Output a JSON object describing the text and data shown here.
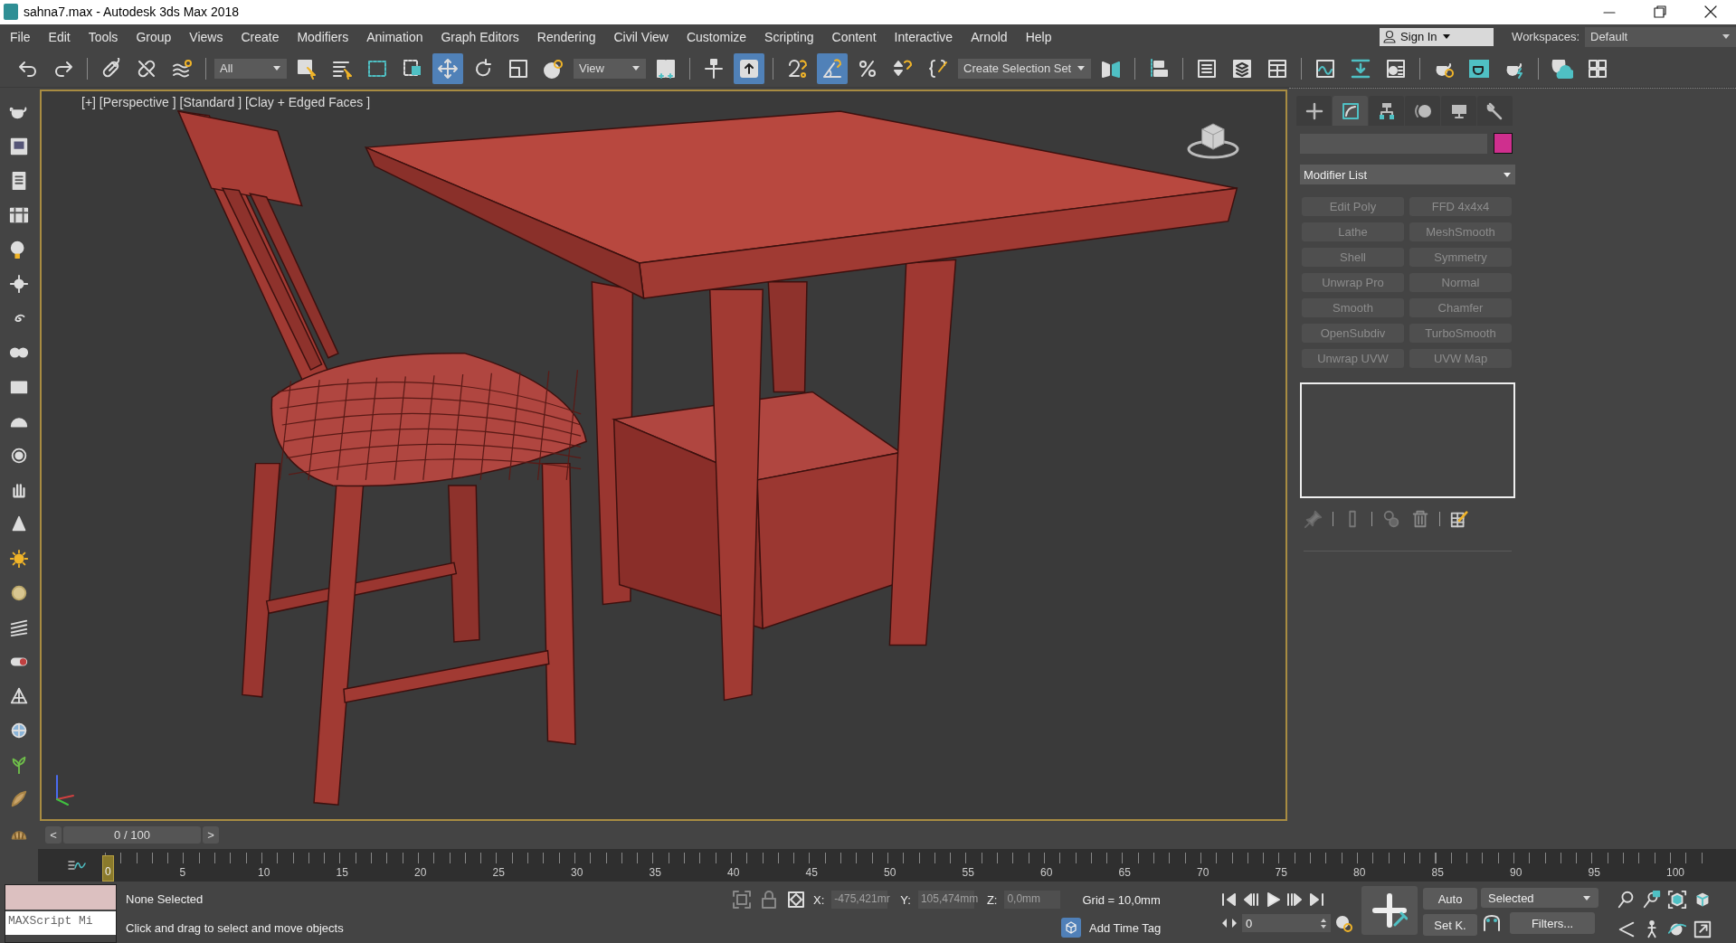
{
  "window": {
    "title": "sahna7.max - Autodesk 3ds Max 2018"
  },
  "menu": [
    "File",
    "Edit",
    "Tools",
    "Group",
    "Views",
    "Create",
    "Modifiers",
    "Animation",
    "Graph Editors",
    "Rendering",
    "Civil View",
    "Customize",
    "Scripting",
    "Content",
    "Interactive",
    "Arnold",
    "Help"
  ],
  "account": {
    "label": "Sign In"
  },
  "workspaces": {
    "label": "Workspaces:",
    "value": "Default"
  },
  "main_toolbar": {
    "items": [
      {
        "kind": "tool",
        "selected": false
      },
      {
        "kind": "tool",
        "selected": false
      },
      {
        "kind": "tool",
        "selected": false
      },
      {
        "kind": "tool",
        "selected": false
      },
      {
        "kind": "tool",
        "selected": false
      },
      {
        "kind": "dropdown",
        "value": "All"
      },
      {
        "kind": "tool",
        "selected": false
      },
      {
        "kind": "tool",
        "selected": false
      },
      {
        "kind": "tool",
        "selected": false
      },
      {
        "kind": "tool",
        "selected": false
      },
      {
        "kind": "tool",
        "selected": true
      },
      {
        "kind": "tool",
        "selected": false
      },
      {
        "kind": "tool",
        "selected": false
      },
      {
        "kind": "tool",
        "selected": false
      },
      {
        "kind": "dropdown",
        "value": "View"
      },
      {
        "kind": "tool",
        "selected": false
      },
      {
        "kind": "tool",
        "selected": false
      },
      {
        "kind": "tool",
        "selected": true
      },
      {
        "kind": "tool",
        "selected": false
      },
      {
        "kind": "tool",
        "selected": true
      },
      {
        "kind": "tool",
        "selected": false
      },
      {
        "kind": "tool",
        "selected": false
      },
      {
        "kind": "tool",
        "selected": false
      },
      {
        "kind": "dropdown",
        "value": "Create Selection Set"
      },
      {
        "kind": "tool",
        "selected": false
      },
      {
        "kind": "tool",
        "selected": false
      },
      {
        "kind": "tool",
        "selected": false
      },
      {
        "kind": "tool",
        "selected": false
      },
      {
        "kind": "tool",
        "selected": false
      },
      {
        "kind": "tool",
        "selected": false
      },
      {
        "kind": "tool",
        "selected": false
      },
      {
        "kind": "tool",
        "selected": false
      },
      {
        "kind": "tool",
        "selected": false
      },
      {
        "kind": "tool",
        "selected": false
      },
      {
        "kind": "tool",
        "selected": false
      },
      {
        "kind": "tool",
        "selected": false
      },
      {
        "kind": "tool",
        "selected": false
      }
    ]
  },
  "viewport": {
    "label": "[+] [Perspective ] [Standard ] [Clay + Edged Faces ]",
    "active": true
  },
  "command_panel": {
    "tabs": [
      {
        "selected": false
      },
      {
        "selected": true
      },
      {
        "selected": false
      },
      {
        "selected": false
      },
      {
        "selected": false
      },
      {
        "selected": false
      }
    ],
    "color_swatch": {
      "color": "#cf2f8e"
    },
    "modifier_list": {
      "value": "Modifier List"
    },
    "modifier_buttons": [
      {
        "label": "Edit Poly",
        "disabled": true
      },
      {
        "label": "FFD 4x4x4",
        "disabled": true
      },
      {
        "label": "Lathe",
        "disabled": true
      },
      {
        "label": "MeshSmooth",
        "disabled": true
      },
      {
        "label": "Shell",
        "disabled": true
      },
      {
        "label": "Symmetry",
        "disabled": true
      },
      {
        "label": "Unwrap Pro",
        "disabled": true
      },
      {
        "label": "Normal",
        "disabled": true
      },
      {
        "label": "Smooth",
        "disabled": true
      },
      {
        "label": "Chamfer",
        "disabled": true
      },
      {
        "label": "OpenSubdiv",
        "disabled": true
      },
      {
        "label": "TurboSmooth",
        "disabled": true
      },
      {
        "label": "Unwrap UVW",
        "disabled": true
      },
      {
        "label": "UVW Map",
        "disabled": true
      }
    ]
  },
  "time_slider": {
    "prev": "<",
    "value": "0 / 100",
    "next": ">"
  },
  "track_bar": {
    "labels": [
      {
        "text": "0",
        "current": true
      },
      {
        "text": "5",
        "current": false
      },
      {
        "text": "10",
        "current": false
      },
      {
        "text": "15",
        "current": false
      },
      {
        "text": "20",
        "current": false
      },
      {
        "text": "25",
        "current": false
      },
      {
        "text": "30",
        "current": false
      },
      {
        "text": "35",
        "current": false
      },
      {
        "text": "40",
        "current": false
      },
      {
        "text": "45",
        "current": false
      },
      {
        "text": "50",
        "current": false
      },
      {
        "text": "55",
        "current": false
      },
      {
        "text": "60",
        "current": false
      },
      {
        "text": "65",
        "current": false
      },
      {
        "text": "70",
        "current": false
      },
      {
        "text": "75",
        "current": false
      },
      {
        "text": "80",
        "current": false
      },
      {
        "text": "85",
        "current": false
      },
      {
        "text": "90",
        "current": false
      },
      {
        "text": "95",
        "current": false
      },
      {
        "text": "100",
        "current": false
      }
    ]
  },
  "status_bar": {
    "listener": "MAXScript Mi",
    "selection": "None Selected",
    "prompt": "Click and drag to select and move objects",
    "coords": [
      {
        "axis": "X:",
        "value": "-475,421mr"
      },
      {
        "axis": "Y:",
        "value": "105,474mm"
      },
      {
        "axis": "Z:",
        "value": "0,0mm"
      }
    ],
    "grid": "Grid = 10,0mm",
    "time_tag": "Add Time Tag",
    "frame": "0",
    "auto_key": "Auto",
    "set_key": "Set K.",
    "key_mode": "Selected",
    "filters": "Filters..."
  }
}
